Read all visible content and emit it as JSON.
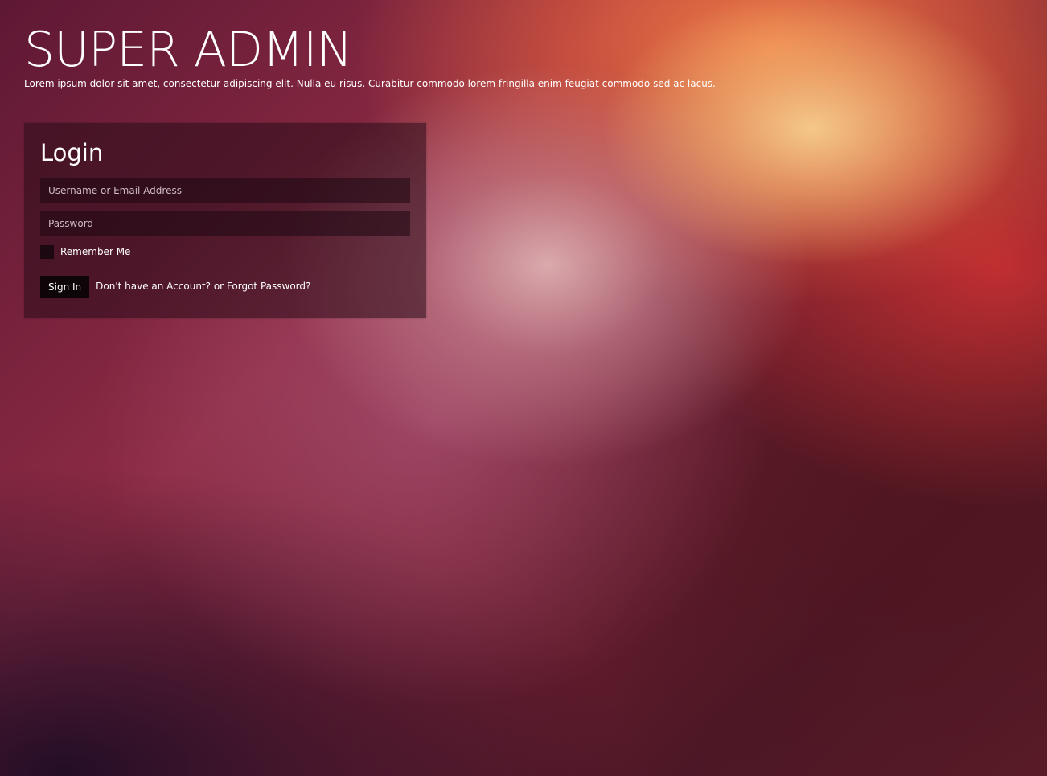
{
  "header": {
    "title": "SUPER ADMIN",
    "subtitle": "Lorem ipsum dolor sit amet, consectetur adipiscing elit. Nulla eu risus. Curabitur commodo lorem fringilla enim feugiat commodo sed ac lacus."
  },
  "login": {
    "heading": "Login",
    "username_placeholder": "Username or Email Address",
    "password_placeholder": "Password",
    "remember_label": "Remember Me",
    "signin_label": "Sign In",
    "no_account_link": "Don't have an Account?",
    "or_text": "or",
    "forgot_link": "Forgot Password?"
  }
}
